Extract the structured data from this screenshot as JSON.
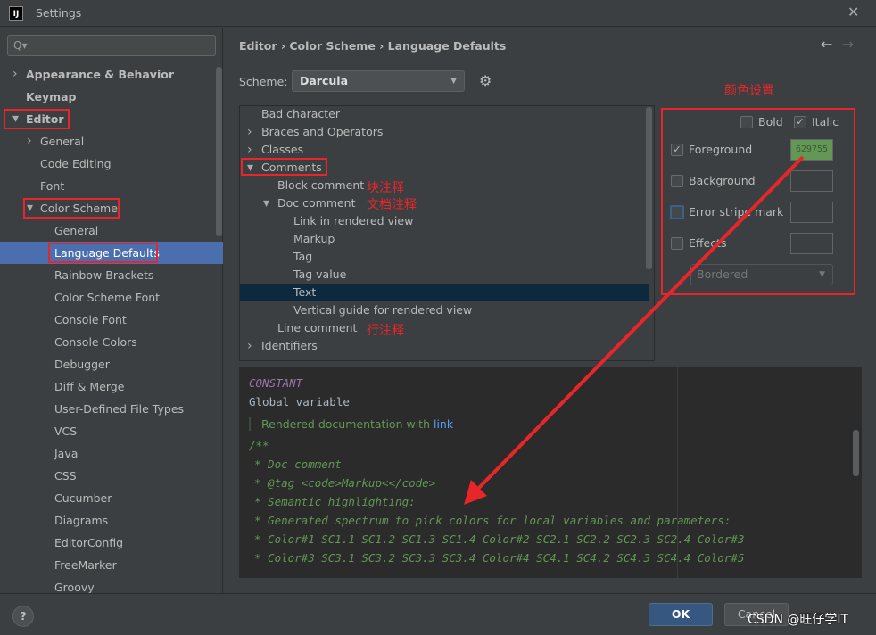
{
  "window": {
    "title": "Settings",
    "app_icon": "IJ"
  },
  "search": {
    "placeholder": "Q▾"
  },
  "sidebar": {
    "items": [
      {
        "label": "Appearance & Behavior",
        "level": 0,
        "arrow": "›",
        "bold": true
      },
      {
        "label": "Keymap",
        "level": 0,
        "arrow": "",
        "bold": true
      },
      {
        "label": "Editor",
        "level": 0,
        "arrow": "⌄",
        "bold": true
      },
      {
        "label": "General",
        "level": 1,
        "arrow": "›"
      },
      {
        "label": "Code Editing",
        "level": 1,
        "arrow": ""
      },
      {
        "label": "Font",
        "level": 1,
        "arrow": ""
      },
      {
        "label": "Color Scheme",
        "level": 1,
        "arrow": "⌄"
      },
      {
        "label": "General",
        "level": 2,
        "arrow": ""
      },
      {
        "label": "Language Defaults",
        "level": 2,
        "arrow": "",
        "selected": true
      },
      {
        "label": "Rainbow Brackets",
        "level": 2
      },
      {
        "label": "Color Scheme Font",
        "level": 2
      },
      {
        "label": "Console Font",
        "level": 2
      },
      {
        "label": "Console Colors",
        "level": 2
      },
      {
        "label": "Debugger",
        "level": 2
      },
      {
        "label": "Diff & Merge",
        "level": 2
      },
      {
        "label": "User-Defined File Types",
        "level": 2
      },
      {
        "label": "VCS",
        "level": 2
      },
      {
        "label": "Java",
        "level": 2
      },
      {
        "label": "CSS",
        "level": 2
      },
      {
        "label": "Cucumber",
        "level": 2
      },
      {
        "label": "Diagrams",
        "level": 2
      },
      {
        "label": "EditorConfig",
        "level": 2
      },
      {
        "label": "FreeMarker",
        "level": 2
      },
      {
        "label": "Groovy",
        "level": 2
      }
    ]
  },
  "breadcrumb": {
    "text": "Editor  ›  Color Scheme  ›  Language Defaults",
    "back": "←",
    "forward": "→"
  },
  "scheme": {
    "label": "Scheme:",
    "value": "Darcula"
  },
  "tree": {
    "items": [
      {
        "label": "Bad character",
        "level": 0,
        "arrow": ""
      },
      {
        "label": "Braces and Operators",
        "level": 0,
        "arrow": "›"
      },
      {
        "label": "Classes",
        "level": 0,
        "arrow": "›"
      },
      {
        "label": "Comments",
        "level": 0,
        "arrow": "⌄"
      },
      {
        "label": "Block comment",
        "level": 1,
        "arrow": ""
      },
      {
        "label": "Doc comment",
        "level": 1,
        "arrow": "⌄"
      },
      {
        "label": "Link in rendered view",
        "level": 2
      },
      {
        "label": "Markup",
        "level": 2
      },
      {
        "label": "Tag",
        "level": 2
      },
      {
        "label": "Tag value",
        "level": 2
      },
      {
        "label": "Text",
        "level": 2,
        "selected": true
      },
      {
        "label": "Vertical guide for rendered view",
        "level": 2
      },
      {
        "label": "Line comment",
        "level": 1,
        "arrow": ""
      },
      {
        "label": "Identifiers",
        "level": 0,
        "arrow": "›"
      }
    ]
  },
  "props": {
    "bold": {
      "label": "Bold",
      "checked": false
    },
    "italic": {
      "label": "Italic",
      "checked": true
    },
    "foreground": {
      "label": "Foreground",
      "checked": true,
      "value": "629755",
      "color": "#629755"
    },
    "background": {
      "label": "Background",
      "checked": false
    },
    "error_stripe": {
      "label": "Error stripe mark",
      "checked": false
    },
    "effects": {
      "label": "Effects",
      "checked": false
    },
    "effect_type": "Bordered"
  },
  "code": {
    "constant": "CONSTANT",
    "global": "Global variable",
    "rendered": "Rendered documentation with ",
    "rendered_link": "link",
    "lines": [
      "/**",
      "* Doc comment",
      "* @tag <code>Markup<</code>",
      "* Semantic highlighting:",
      "* Generated spectrum to pick colors for local variables and parameters:",
      "*  Color#1 SC1.1 SC1.2 SC1.3 SC1.4 Color#2 SC2.1 SC2.2 SC2.3 SC2.4 Color#3",
      "*  Color#3 SC3.1 SC3.2 SC3.3 SC3.4 Color#4 SC4.1 SC4.2 SC4.3 SC4.4 Color#5"
    ]
  },
  "footer": {
    "help": "?",
    "ok": "OK",
    "cancel": "Cancel"
  },
  "annotations": {
    "color_settings": "颜色设置",
    "block": "块注释",
    "doc": "文档注释",
    "line": "行注释",
    "accent": "#e8262a"
  },
  "watermark": "CSDN @旺仔学IT"
}
